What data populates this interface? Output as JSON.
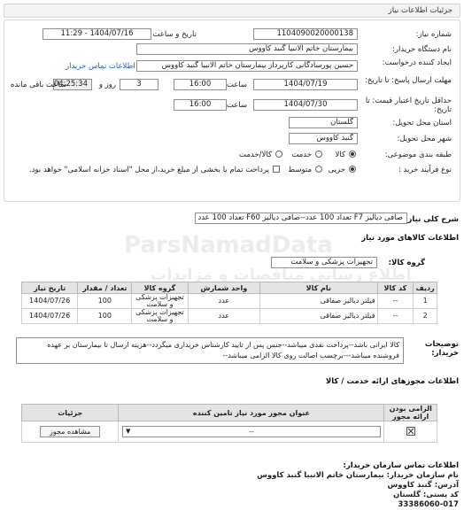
{
  "header": {
    "title": "جزئیات اطلاعات نیاز"
  },
  "need": {
    "number_label": "شماره نیاز:",
    "number": "1104090020000138",
    "announce_label": "تاریخ و ساعت اعلان عمومی:",
    "announce": "1404/07/16 - 11:29",
    "buyer_label": "نام دستگاه خریدار:",
    "buyer": "بیمارستان خاتم الانبیا گنبد کاووس",
    "creator_label": "ایجاد کننده درخواست:",
    "creator": "حسین پورسادگانی کارپرداز بیمارستان خاتم الانبیا گنبد کاووس",
    "contact_link": "اطلاعات تماس خریدار",
    "deadline_label": "مهلت ارسال پاسخ: تا تاریخ:",
    "deadline_date": "1404/07/19",
    "time_label": "ساعت",
    "deadline_time": "16:00",
    "days": "3",
    "day_label": "روز و",
    "remain_time": "04:25:34",
    "remain_label": "ساعت باقی مانده",
    "validity_label": "حداقل تاریخ اعتبار قیمت: تا تاریخ:",
    "validity_date": "1404/07/30",
    "validity_time": "16:00",
    "province_label": "استان محل تحویل:",
    "province": "گلستان",
    "city_label": "شهر محل تحویل:",
    "city": "گنبد کاووس",
    "category_label": "طبقه بندی موضوعی:",
    "cat_goods": "کالا",
    "cat_service": "خدمت",
    "cat_goods_service": "کالا/خدمت",
    "process_label": "نوع فرآیند خرید :",
    "proc_partial": "جزیی",
    "proc_medium": "متوسط",
    "payment_note": "پرداخت تمام یا بخشی از مبلغ خرید،از محل \"اسناد خزانه اسلامی\" خواهد بود."
  },
  "summary": {
    "label": "شرح کلی نیاز:",
    "text": "صافی دیالیز F7 تعداد 100 عدد--صافی دیالیز F60 تعداد 100 عدد"
  },
  "goods": {
    "section_title": "اطلاعات کالاهای مورد نیاز",
    "group_label": "گروه کالا:",
    "group_value": "تجهیزات پزشکی و سلامت",
    "columns": [
      "ردیف",
      "کد کالا",
      "نام کالا",
      "واحد شمارش",
      "گروه کالا",
      "تعداد / مقدار",
      "تاریخ نیاز"
    ],
    "rows": [
      {
        "row": "1",
        "code": "--",
        "name": "فیلتر دیالیز صفاقی",
        "unit": "عدد",
        "group": "تجهیزات پزشکی و سلامت",
        "qty": "100",
        "date": "1404/07/26"
      },
      {
        "row": "2",
        "code": "--",
        "name": "فیلتر دیالیز صفاقی",
        "unit": "عدد",
        "group": "تجهیزات پزشکی و سلامت",
        "qty": "100",
        "date": "1404/07/26"
      }
    ]
  },
  "notes": {
    "label": "توضیحات خریدار:",
    "text": "کالا ایرانی باشد--پرداخت نقدی میباشد--جنس پس از تایید کارشناس خریداری میگردد--هزینه ارسال تا بیمارستان بر عهده فروشنده میباشد---برچسب اصالت روی کالا الزامی میباشد--"
  },
  "permits": {
    "section_title": "اطلاعات مجوزهای ارائه خدمت / کالا",
    "col_required": "الزامی بودن ارائه مجوز",
    "col_title": "عنوان مجوز مورد نیاز تامین کننده",
    "col_details": "جزئیات",
    "select_value": "--",
    "view_button": "مشاهده مجوز"
  },
  "org": {
    "section_title": "اطلاعات تماس سازمان خریدار:",
    "buyer_name": "نام سازمان خریدار: بیمارستان خاتم الانبیا گنبد کاووس",
    "address": "آدرس: گنبد کاووس",
    "postcode": "کد پستی: گلستان",
    "phone": "33386060-017"
  },
  "watermark": {
    "line1": "ParsNamadData",
    "line2": "اطلاع رسانی مناقصات و مزایدات",
    "line3": "ParsNamadData"
  }
}
